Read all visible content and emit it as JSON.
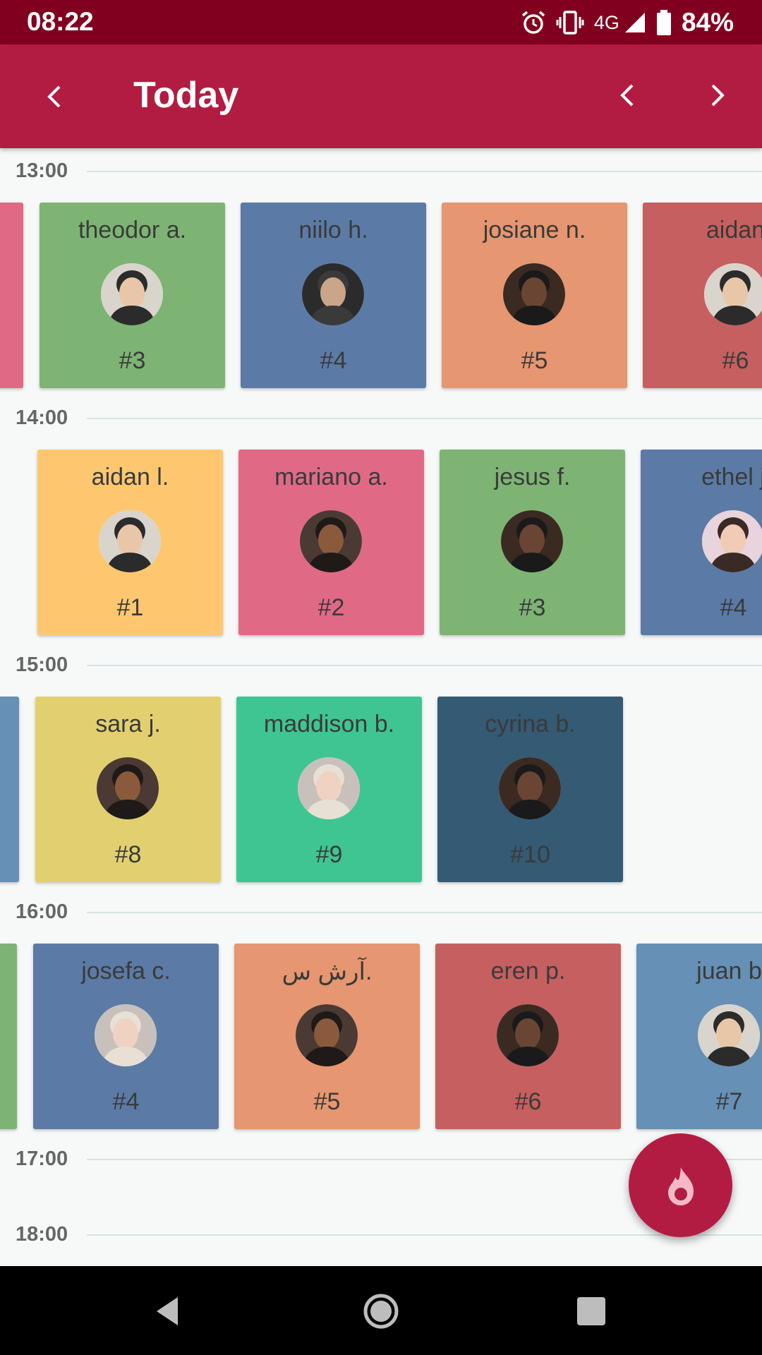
{
  "status": {
    "time": "08:22",
    "network": "4G",
    "battery": "84%"
  },
  "header": {
    "title": "Today"
  },
  "timeline": {
    "slots": [
      "13:00",
      "14:00",
      "15:00",
      "16:00",
      "17:00",
      "18:00"
    ]
  },
  "rows": [
    [
      {
        "name": "",
        "number": "",
        "color": "#e06a85",
        "avatar": "none"
      },
      {
        "name": "theodor a.",
        "number": "#3",
        "color": "#7db474",
        "avatar": "light"
      },
      {
        "name": "niilo h.",
        "number": "#4",
        "color": "#5b7ba6",
        "avatar": "dark"
      },
      {
        "name": "josiane n.",
        "number": "#5",
        "color": "#e69670",
        "avatar": "deep"
      },
      {
        "name": "aidan",
        "number": "#6",
        "color": "#c65f5f",
        "avatar": "light"
      }
    ],
    [
      {
        "name": "aidan l.",
        "number": "#1",
        "color": "#fec76f",
        "avatar": "light"
      },
      {
        "name": "mariano a.",
        "number": "#2",
        "color": "#e06a85",
        "avatar": "brown"
      },
      {
        "name": "jesus f.",
        "number": "#3",
        "color": "#7db474",
        "avatar": "deep"
      },
      {
        "name": "ethel j",
        "number": "#4",
        "color": "#5b7ba6",
        "avatar": "pink"
      }
    ],
    [
      {
        "name": "",
        "number": "",
        "color": "#6690b5",
        "avatar": "none"
      },
      {
        "name": "sara j.",
        "number": "#8",
        "color": "#e2d070",
        "avatar": "brown"
      },
      {
        "name": "maddison b.",
        "number": "#9",
        "color": "#3ec592",
        "avatar": "pale"
      },
      {
        "name": "cyrina b.",
        "number": "#10",
        "color": "#345a74",
        "avatar": "deep"
      }
    ],
    [
      {
        "name": "",
        "number": "",
        "color": "#7db474",
        "avatar": "none"
      },
      {
        "name": "josefa c.",
        "number": "#4",
        "color": "#5b7ba6",
        "avatar": "pale"
      },
      {
        "name": "آرش س.",
        "number": "#5",
        "color": "#e69670",
        "avatar": "brown"
      },
      {
        "name": "eren p.",
        "number": "#6",
        "color": "#c65f5f",
        "avatar": "deep"
      },
      {
        "name": "juan b",
        "number": "#7",
        "color": "#6690b5",
        "avatar": "light"
      }
    ]
  ]
}
